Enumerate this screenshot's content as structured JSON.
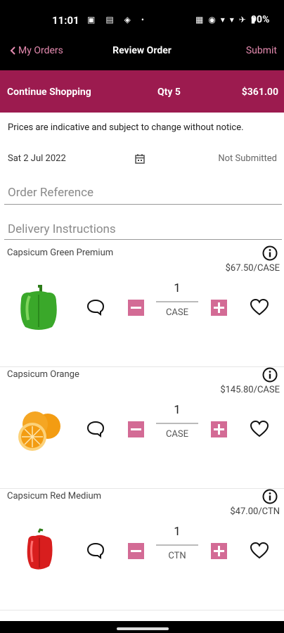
{
  "status_bar": {
    "time": "11:01",
    "battery": "90%"
  },
  "nav": {
    "back_label": "My Orders",
    "title": "Review Order",
    "submit_label": "Submit"
  },
  "summary": {
    "continue_label": "Continue Shopping",
    "qty": "Qty 5",
    "total": "$361.00"
  },
  "notice": "Prices are indicative and subject to change without notice.",
  "order": {
    "date": "Sat 2 Jul 2022",
    "status": "Not Submitted"
  },
  "fields": {
    "order_reference_placeholder": "Order Reference",
    "delivery_placeholder": "Delivery Instructions"
  },
  "products": [
    {
      "name": "Capsicum Green Premium",
      "price": "$67.50/CASE",
      "qty": "1",
      "unit": "CASE",
      "image": "green-capsicum",
      "color": "#3aa82a"
    },
    {
      "name": "Capsicum Orange",
      "price": "$145.80/CASE",
      "qty": "1",
      "unit": "CASE",
      "image": "oranges",
      "color": "#f39c12"
    },
    {
      "name": "Capsicum Red Medium",
      "price": "$47.00/CTN",
      "qty": "1",
      "unit": "CTN",
      "image": "red-capsicum",
      "color": "#d81e1e"
    }
  ],
  "colors": {
    "brand": "#9c1b4f",
    "accent": "#e58bb0",
    "stepper": "#d36b95"
  }
}
